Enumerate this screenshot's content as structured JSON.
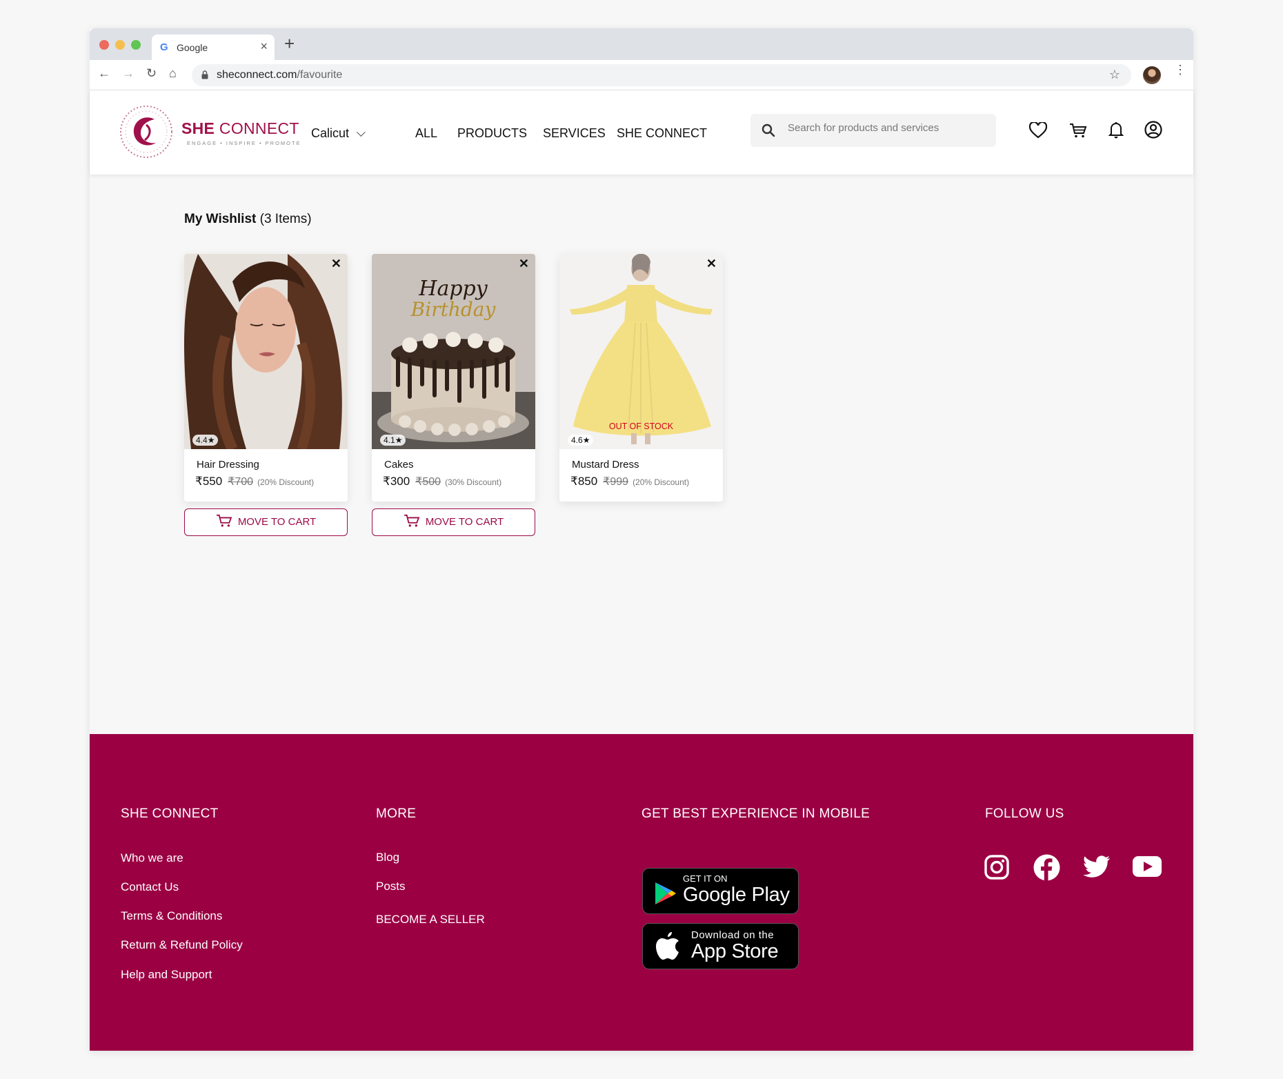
{
  "browser": {
    "tab_title": "Google",
    "url_domain": "sheconnect.com",
    "url_path": "/favourite"
  },
  "header": {
    "brand_primary": "SHE",
    "brand_secondary": "CONNECT",
    "tagline": "ENGAGE • INSPIRE • PROMOTE",
    "city": "Calicut",
    "nav": [
      "ALL",
      "PRODUCTS",
      "SERVICES",
      "SHE CONNECT"
    ],
    "search_placeholder": "Search for products and services",
    "icons": [
      "heart-icon",
      "cart-icon",
      "bell-icon",
      "account-icon"
    ]
  },
  "wishlist": {
    "title": "My Wishlist",
    "count_text": "(3 Items)",
    "items": [
      {
        "name": "Hair Dressing",
        "rating": "4.4",
        "price": "₹550",
        "old_price": "₹700",
        "discount": "(20% Discount)",
        "out_of_stock": false,
        "action": "MOVE TO CART"
      },
      {
        "name": "Cakes",
        "rating": "4.1",
        "price": "₹300",
        "old_price": "₹500",
        "discount": "(30% Discount)",
        "out_of_stock": false,
        "action": "MOVE TO CART"
      },
      {
        "name": "Mustard Dress",
        "rating": "4.6",
        "price": "₹850",
        "old_price": "₹999",
        "discount": "(20% Discount)",
        "out_of_stock": true,
        "stock_label": "OUT OF STOCK"
      }
    ]
  },
  "footer": {
    "col1": {
      "title": "SHE CONNECT",
      "links": [
        "Who we are",
        "Contact Us",
        "Terms & Conditions",
        "Return & Refund Policy",
        "Help and Support"
      ]
    },
    "col2": {
      "title": "MORE",
      "links": [
        "Blog",
        "Posts"
      ],
      "seller": "BECOME A SELLER"
    },
    "col3": {
      "title": "GET BEST EXPERIENCE IN MOBILE",
      "google_small": "GET IT ON",
      "google_big": "Google Play",
      "apple_small": "Download on the",
      "apple_big": "App Store"
    },
    "col4": {
      "title": "FOLLOW US",
      "icons": [
        "instagram-icon",
        "facebook-icon",
        "twitter-icon",
        "youtube-icon"
      ]
    }
  },
  "colors": {
    "brand": "#9b0043",
    "accent": "#a0104a",
    "out_of_stock": "#d0021b"
  }
}
